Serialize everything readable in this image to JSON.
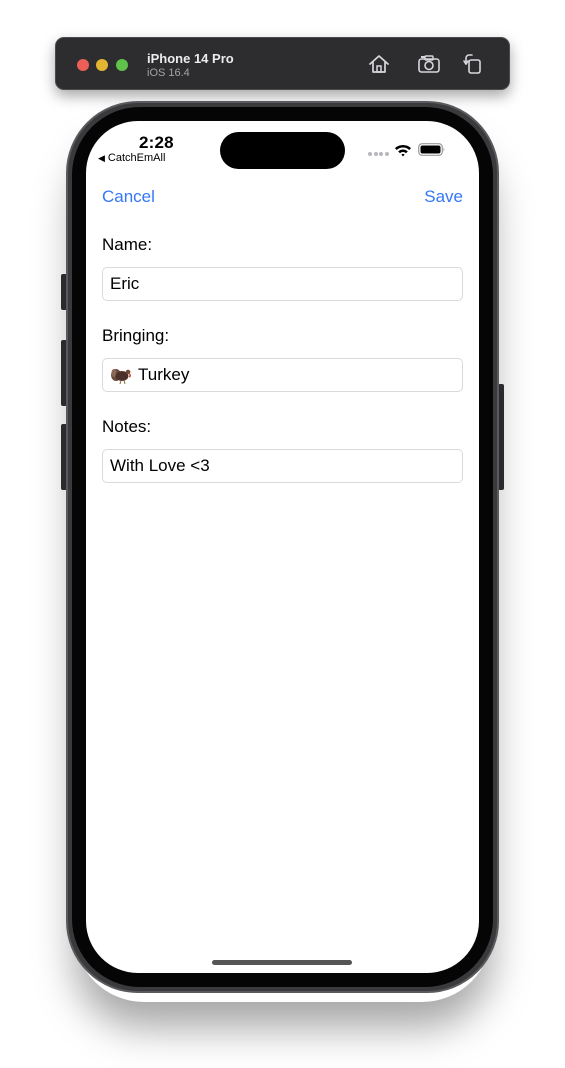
{
  "simulator": {
    "device_name": "iPhone 14 Pro",
    "os_version": "iOS 16.4",
    "buttons": [
      "home-icon",
      "screenshot-icon",
      "rotate-icon"
    ]
  },
  "status_bar": {
    "time": "2:28",
    "back_app": "CatchEmAll"
  },
  "nav": {
    "cancel_label": "Cancel",
    "save_label": "Save",
    "accent_color": "#3478f6"
  },
  "form": {
    "name": {
      "label": "Name:",
      "value": "Eric"
    },
    "bringing": {
      "label": "Bringing:",
      "emoji_icon": "turkey-icon",
      "value": "Turkey"
    },
    "notes": {
      "label": "Notes:",
      "value": "With Love <3"
    }
  }
}
